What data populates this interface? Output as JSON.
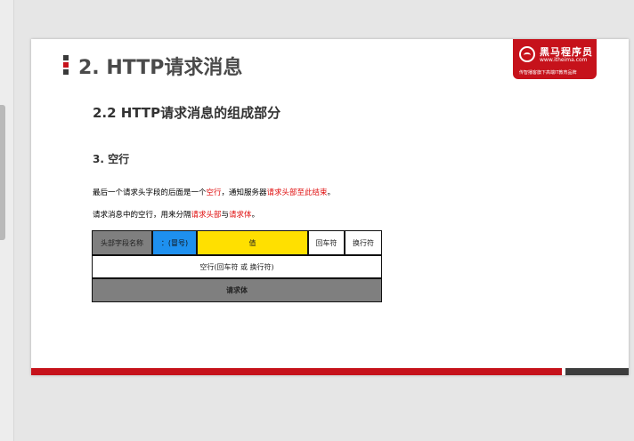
{
  "slide": {
    "title": "2. HTTP请求消息",
    "subtitle": "2.2 HTTP请求消息的组成部分",
    "section": "3. 空行",
    "para1": {
      "before": "最后一个请求头字段的后面是一个",
      "hl1": "空行",
      "mid": "，通知服务器",
      "hl2": "请求头部至此结束",
      "end": "。"
    },
    "para2": {
      "before": "请求消息中的空行，用来分隔",
      "hl1": "请求头部",
      "mid": "与",
      "hl2": "请求体",
      "end": "。"
    }
  },
  "logo": {
    "name": "黑马程序员",
    "url": "www.itheima.com",
    "slogan": "传智播客旗下高端IT教育品牌"
  },
  "diagram": {
    "field_name": "头部字段名称",
    "colon": "：(冒号)",
    "value": "值",
    "cr": "回车符",
    "lf": "换行符",
    "blank_line": "空行(回车符 或 换行符)",
    "body": "请求体"
  },
  "colors": {
    "accent": "#c6121b",
    "highlight": "#e01010",
    "colon_cell": "#1e90ef",
    "value_cell": "#ffe000",
    "gray_cell": "#7f7f7f"
  }
}
